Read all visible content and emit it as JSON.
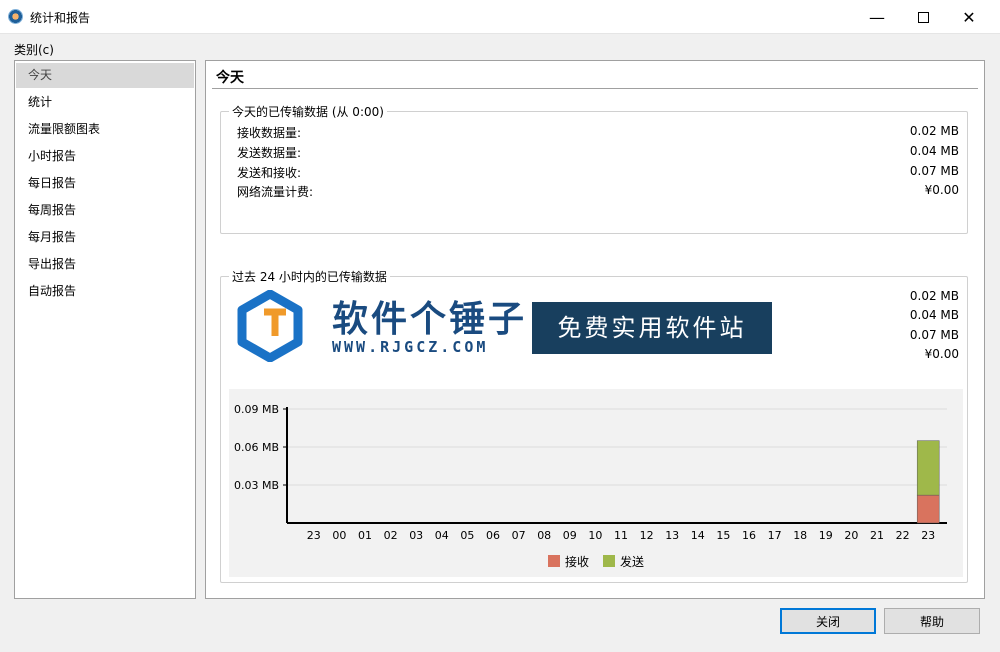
{
  "window": {
    "title": "统计和报告",
    "minimize_glyph": "—",
    "close_glyph": "✕",
    "icon": "app-icon"
  },
  "category_label": "类别(c)",
  "sidebar": {
    "items": [
      {
        "label": "今天",
        "selected": true
      },
      {
        "label": "统计"
      },
      {
        "label": "流量限额图表"
      },
      {
        "label": "小时报告"
      },
      {
        "label": "每日报告"
      },
      {
        "label": "每周报告"
      },
      {
        "label": "每月报告"
      },
      {
        "label": "导出报告"
      },
      {
        "label": "自动报告"
      }
    ]
  },
  "panel": {
    "title": "今天",
    "today_group": {
      "caption": "今天的已传输数据 (从 0:00)",
      "rows": [
        {
          "label": "接收数据量:",
          "value": "0.02 MB"
        },
        {
          "label": "发送数据量:",
          "value": "0.04 MB"
        },
        {
          "label": "发送和接收:",
          "value": "0.07 MB"
        },
        {
          "label": "网络流量计费:",
          "value": "¥0.00"
        }
      ]
    },
    "last24_group": {
      "caption": "过去 24 小时内的已传输数据",
      "values": [
        "0.02 MB",
        "0.04 MB",
        "0.07 MB",
        "¥0.00"
      ]
    }
  },
  "chart_data": {
    "type": "bar",
    "stacked": true,
    "categories": [
      "23",
      "00",
      "01",
      "02",
      "03",
      "04",
      "05",
      "06",
      "07",
      "08",
      "09",
      "10",
      "11",
      "12",
      "13",
      "14",
      "15",
      "16",
      "17",
      "18",
      "19",
      "20",
      "21",
      "22",
      "23"
    ],
    "series": [
      {
        "name": "接收",
        "color": "#d9735e",
        "values": [
          0,
          0,
          0,
          0,
          0,
          0,
          0,
          0,
          0,
          0,
          0,
          0,
          0,
          0,
          0,
          0,
          0,
          0,
          0,
          0,
          0,
          0,
          0,
          0,
          0.022
        ]
      },
      {
        "name": "发送",
        "color": "#9fb84a",
        "values": [
          0,
          0,
          0,
          0,
          0,
          0,
          0,
          0,
          0,
          0,
          0,
          0,
          0,
          0,
          0,
          0,
          0,
          0,
          0,
          0,
          0,
          0,
          0,
          0,
          0.043
        ]
      }
    ],
    "y_ticks": [
      "0.09 MB",
      "0.06 MB",
      "0.03 MB"
    ],
    "y_tick_values": [
      0.09,
      0.06,
      0.03
    ],
    "ylim": [
      0,
      0.09
    ],
    "grid": true,
    "legend": "bottom-center"
  },
  "watermark": {
    "name": "软件个锤子",
    "url": "WWW.RJGCZ.COM",
    "slogan": "免费实用软件站"
  },
  "buttons": {
    "close": "关闭",
    "help": "帮助"
  }
}
